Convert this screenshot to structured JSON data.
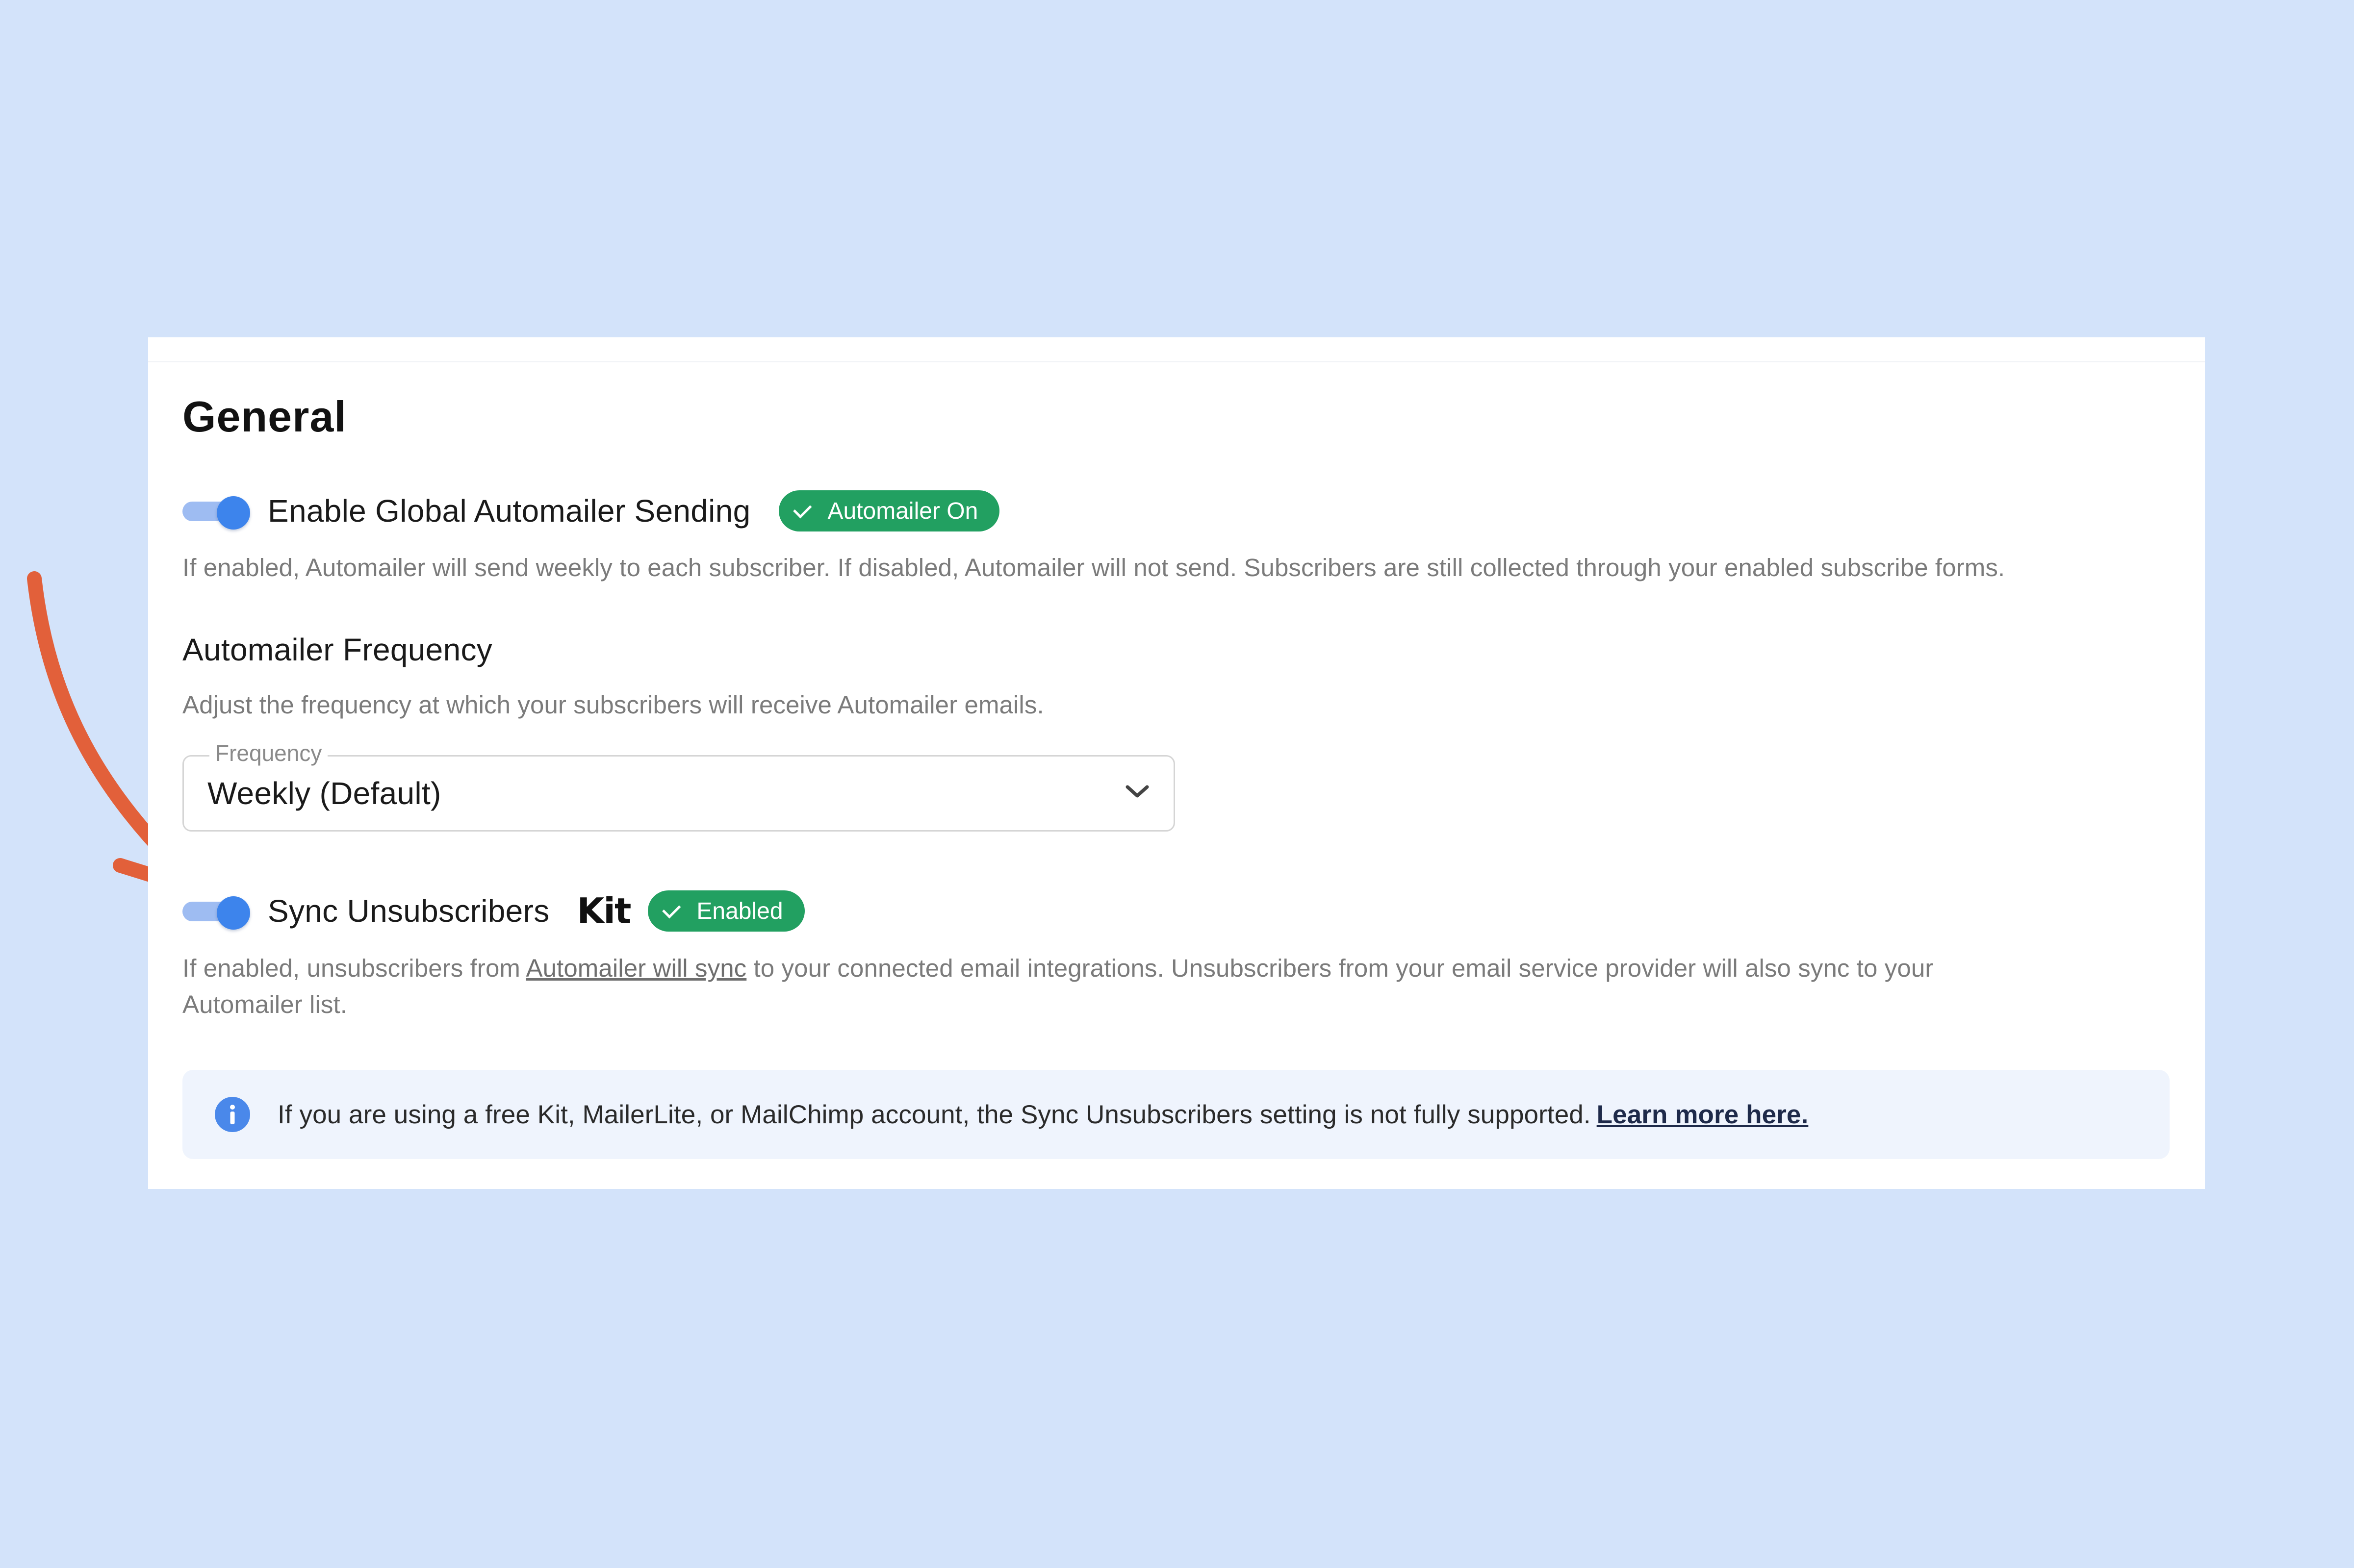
{
  "colors": {
    "background": "#d3e3fa",
    "card": "#ffffff",
    "toggle_on": "#3d84ec",
    "badge_success": "#22a061",
    "info_background": "#eff4fd",
    "annotation_arrow": "#e2603a"
  },
  "general": {
    "title": "General",
    "global_sending": {
      "label": "Enable Global Automailer Sending",
      "enabled": true,
      "badge": "Automailer On",
      "description": "If enabled, Automailer will send weekly to each subscriber. If disabled, Automailer will not send. Subscribers are still collected through your enabled subscribe forms."
    },
    "frequency": {
      "heading": "Automailer Frequency",
      "description": "Adjust the frequency at which your subscribers will receive Automailer emails.",
      "field_label": "Frequency",
      "selected": "Weekly (Default)",
      "icon": "chevron-down-icon"
    },
    "sync_unsubscribers": {
      "label": "Sync Unsubscribers",
      "enabled": true,
      "integration_logo": "Kit",
      "badge": "Enabled",
      "description_before": "If enabled, unsubscribers from ",
      "description_link": "Automailer will sync",
      "description_after": " to your connected email integrations. Unsubscribers from your email service provider will also sync to your",
      "description_line2": "Automailer list."
    },
    "info": {
      "icon": "info-icon",
      "text": "If you are using a free Kit, MailerLite, or MailChimp account, the Sync Unsubscribers setting is not fully supported.",
      "link": "Learn more here."
    }
  }
}
